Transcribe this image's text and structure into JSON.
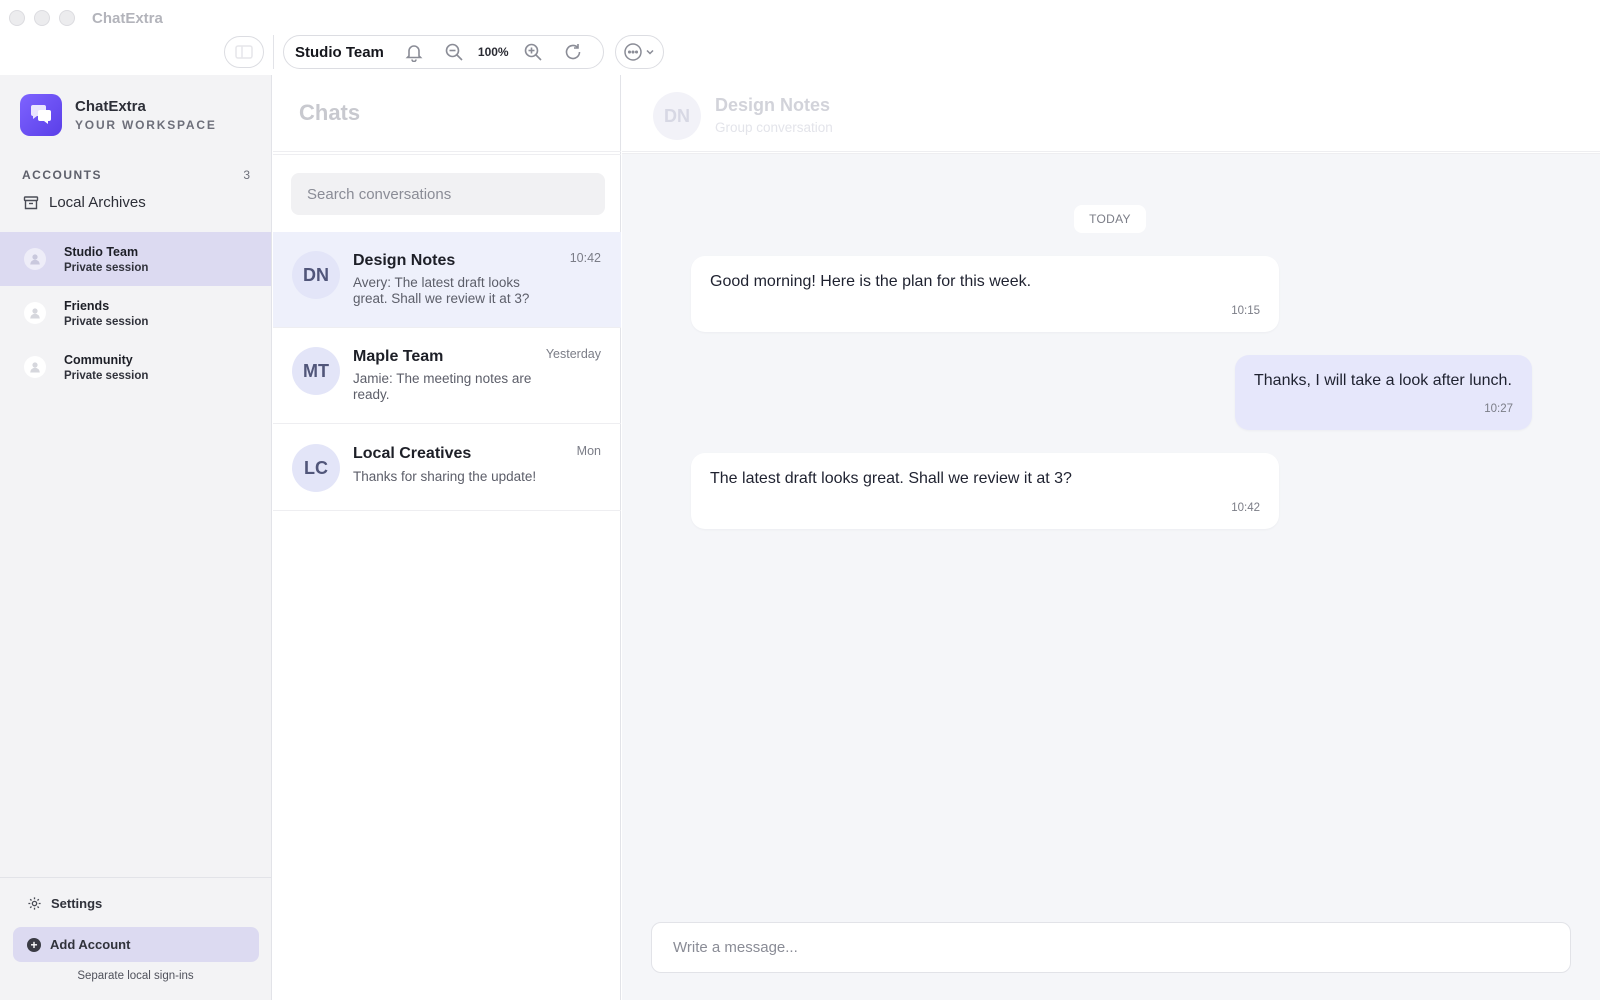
{
  "window": {
    "app_title": "ChatExtra"
  },
  "toolbar": {
    "account_title": "Studio Team",
    "zoom_level": "100%"
  },
  "sidebar": {
    "brand_name": "ChatExtra",
    "brand_subtitle": "YOUR WORKSPACE",
    "accounts_label": "ACCOUNTS",
    "accounts_count": "3",
    "archives_label": "Local Archives",
    "accounts": [
      {
        "name": "Studio Team",
        "status": "Private session",
        "active": true
      },
      {
        "name": "Friends",
        "status": "Private session",
        "active": false
      },
      {
        "name": "Community",
        "status": "Private session",
        "active": false
      }
    ],
    "settings_label": "Settings",
    "add_account_label": "Add Account",
    "footer_note": "Separate local sign-ins"
  },
  "chatlist": {
    "title": "Chats",
    "search_placeholder": "Search conversations",
    "conversations": [
      {
        "initials": "DN",
        "name": "Design Notes",
        "time": "10:42",
        "preview": "Avery: The latest draft looks great. Shall we review it at 3?",
        "active": true
      },
      {
        "initials": "MT",
        "name": "Maple Team",
        "time": "Yesterday",
        "preview": "Jamie: The meeting notes are ready.",
        "active": false
      },
      {
        "initials": "LC",
        "name": "Local Creatives",
        "time": "Mon",
        "preview": "Thanks for sharing the update!",
        "active": false
      }
    ]
  },
  "conversation": {
    "initials": "DN",
    "title": "Design Notes",
    "subtitle": "Group conversation",
    "day_label": "TODAY",
    "messages": [
      {
        "text": "Good morning! Here is the plan for this week.",
        "time": "10:15",
        "outgoing": false
      },
      {
        "text": "Thanks, I will take a look after lunch.",
        "time": "10:27",
        "outgoing": true
      },
      {
        "text": "The latest draft looks great. Shall we review it at 3?",
        "time": "10:42",
        "outgoing": false
      }
    ],
    "composer_placeholder": "Write a message..."
  },
  "colors": {
    "accent": "#6a4ff5",
    "active_row": "#dcdaf1",
    "outgoing_bubble": "#e6e7fb"
  }
}
